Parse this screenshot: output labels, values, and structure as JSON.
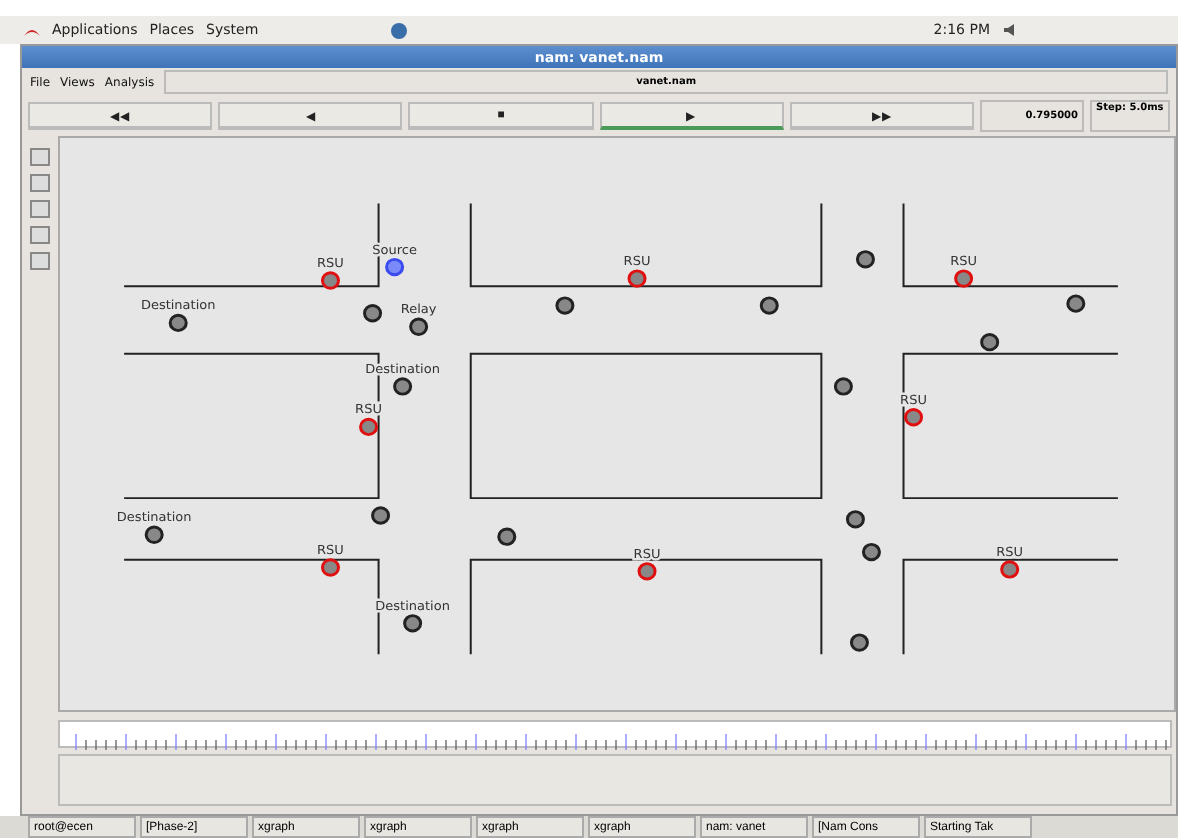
{
  "top_panel": {
    "menus": [
      "Applications",
      "Places",
      "System"
    ],
    "clock": "2:16 PM"
  },
  "window": {
    "title": "nam: vanet.nam"
  },
  "menubar": {
    "menus": [
      "File",
      "Views",
      "Analysis"
    ],
    "file_name": "vanet.nam"
  },
  "controls": {
    "buttons": [
      {
        "label": "◀◀",
        "selected": false
      },
      {
        "label": "◀",
        "selected": false
      },
      {
        "label": "■",
        "selected": false
      },
      {
        "label": "▶",
        "selected": true
      },
      {
        "label": "▶▶",
        "selected": false
      }
    ],
    "time": "0.795000",
    "step": "Step: 5.0ms"
  },
  "nodes": [
    {
      "kind": "rsu",
      "label": "RSU"
    },
    {
      "kind": "source",
      "label": "Source"
    },
    {
      "kind": "vehicle",
      "label": "Destination"
    },
    {
      "kind": "vehicle"
    },
    {
      "kind": "vehicle",
      "label": "Relay"
    },
    {
      "kind": "vehicle",
      "label": "Destination"
    },
    {
      "kind": "rsu",
      "label": "RSU"
    },
    {
      "kind": "vehicle"
    },
    {
      "kind": "rsu",
      "label": "RSU"
    },
    {
      "kind": "vehicle"
    },
    {
      "kind": "vehicle"
    },
    {
      "kind": "rsu",
      "label": "RSU"
    },
    {
      "kind": "vehicle"
    },
    {
      "kind": "vehicle"
    },
    {
      "kind": "vehicle"
    },
    {
      "kind": "rsu",
      "label": "RSU"
    },
    {
      "kind": "vehicle"
    },
    {
      "kind": "vehicle"
    },
    {
      "kind": "vehicle",
      "label": "Destination"
    },
    {
      "kind": "rsu",
      "label": "RSU"
    },
    {
      "kind": "vehicle",
      "label": "Destination"
    },
    {
      "kind": "rsu",
      "label": "RSU"
    },
    {
      "kind": "vehicle"
    },
    {
      "kind": "vehicle"
    },
    {
      "kind": "vehicle"
    },
    {
      "kind": "rsu",
      "label": "RSU"
    }
  ],
  "taskbar": [
    "root@ecen",
    "[Phase-2]",
    "xgraph",
    "xgraph",
    "xgraph",
    "xgraph",
    "nam: vanet",
    "[Nam Cons",
    "Starting Tak"
  ]
}
